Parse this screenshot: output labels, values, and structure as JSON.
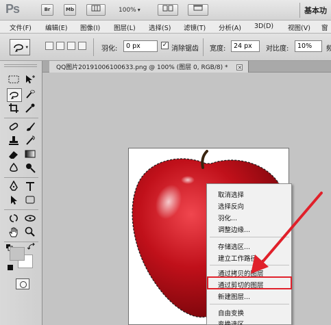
{
  "titlebar": {
    "logo": "Ps",
    "br_label": "Br",
    "mb_label": "Mb",
    "zoom": "100%",
    "workspace": "基本功"
  },
  "menubar": {
    "items": [
      "文件(F)",
      "编辑(E)",
      "图像(I)",
      "图层(L)",
      "选择(S)",
      "滤镜(T)",
      "分析(A)",
      "3D(D)",
      "视图(V)",
      "窗"
    ]
  },
  "options": {
    "feather_label": "羽化:",
    "feather_value": "0 px",
    "antialias_label": "消除锯齿",
    "antialias_checked": true,
    "width_label": "宽度:",
    "width_value": "24 px",
    "contrast_label": "对比度:",
    "contrast_value": "10%",
    "frequency_label": "频"
  },
  "document": {
    "tab_title": "QQ图片20191006100633.png @ 100% (图层 0, RGB/8) *",
    "close_symbol": "×"
  },
  "context_menu": {
    "items": [
      {
        "label": "取消选择",
        "disabled": false
      },
      {
        "label": "选择反向",
        "disabled": false
      },
      {
        "label": "羽化...",
        "disabled": false
      },
      {
        "label": "调整边缘...",
        "disabled": false
      },
      {
        "label": "存储选区...",
        "disabled": false
      },
      {
        "label": "建立工作路径...",
        "disabled": false
      },
      {
        "label": "通过拷贝的图层",
        "disabled": false
      },
      {
        "label": "通过剪切的图层",
        "disabled": false,
        "highlighted": true
      },
      {
        "label": "新建图层...",
        "disabled": false
      },
      {
        "label": "自由变换",
        "disabled": false
      },
      {
        "label": "变换选区",
        "disabled": false
      }
    ]
  },
  "colors": {
    "annotation_red": "#e0202a",
    "apple_red": "#c0101a"
  }
}
